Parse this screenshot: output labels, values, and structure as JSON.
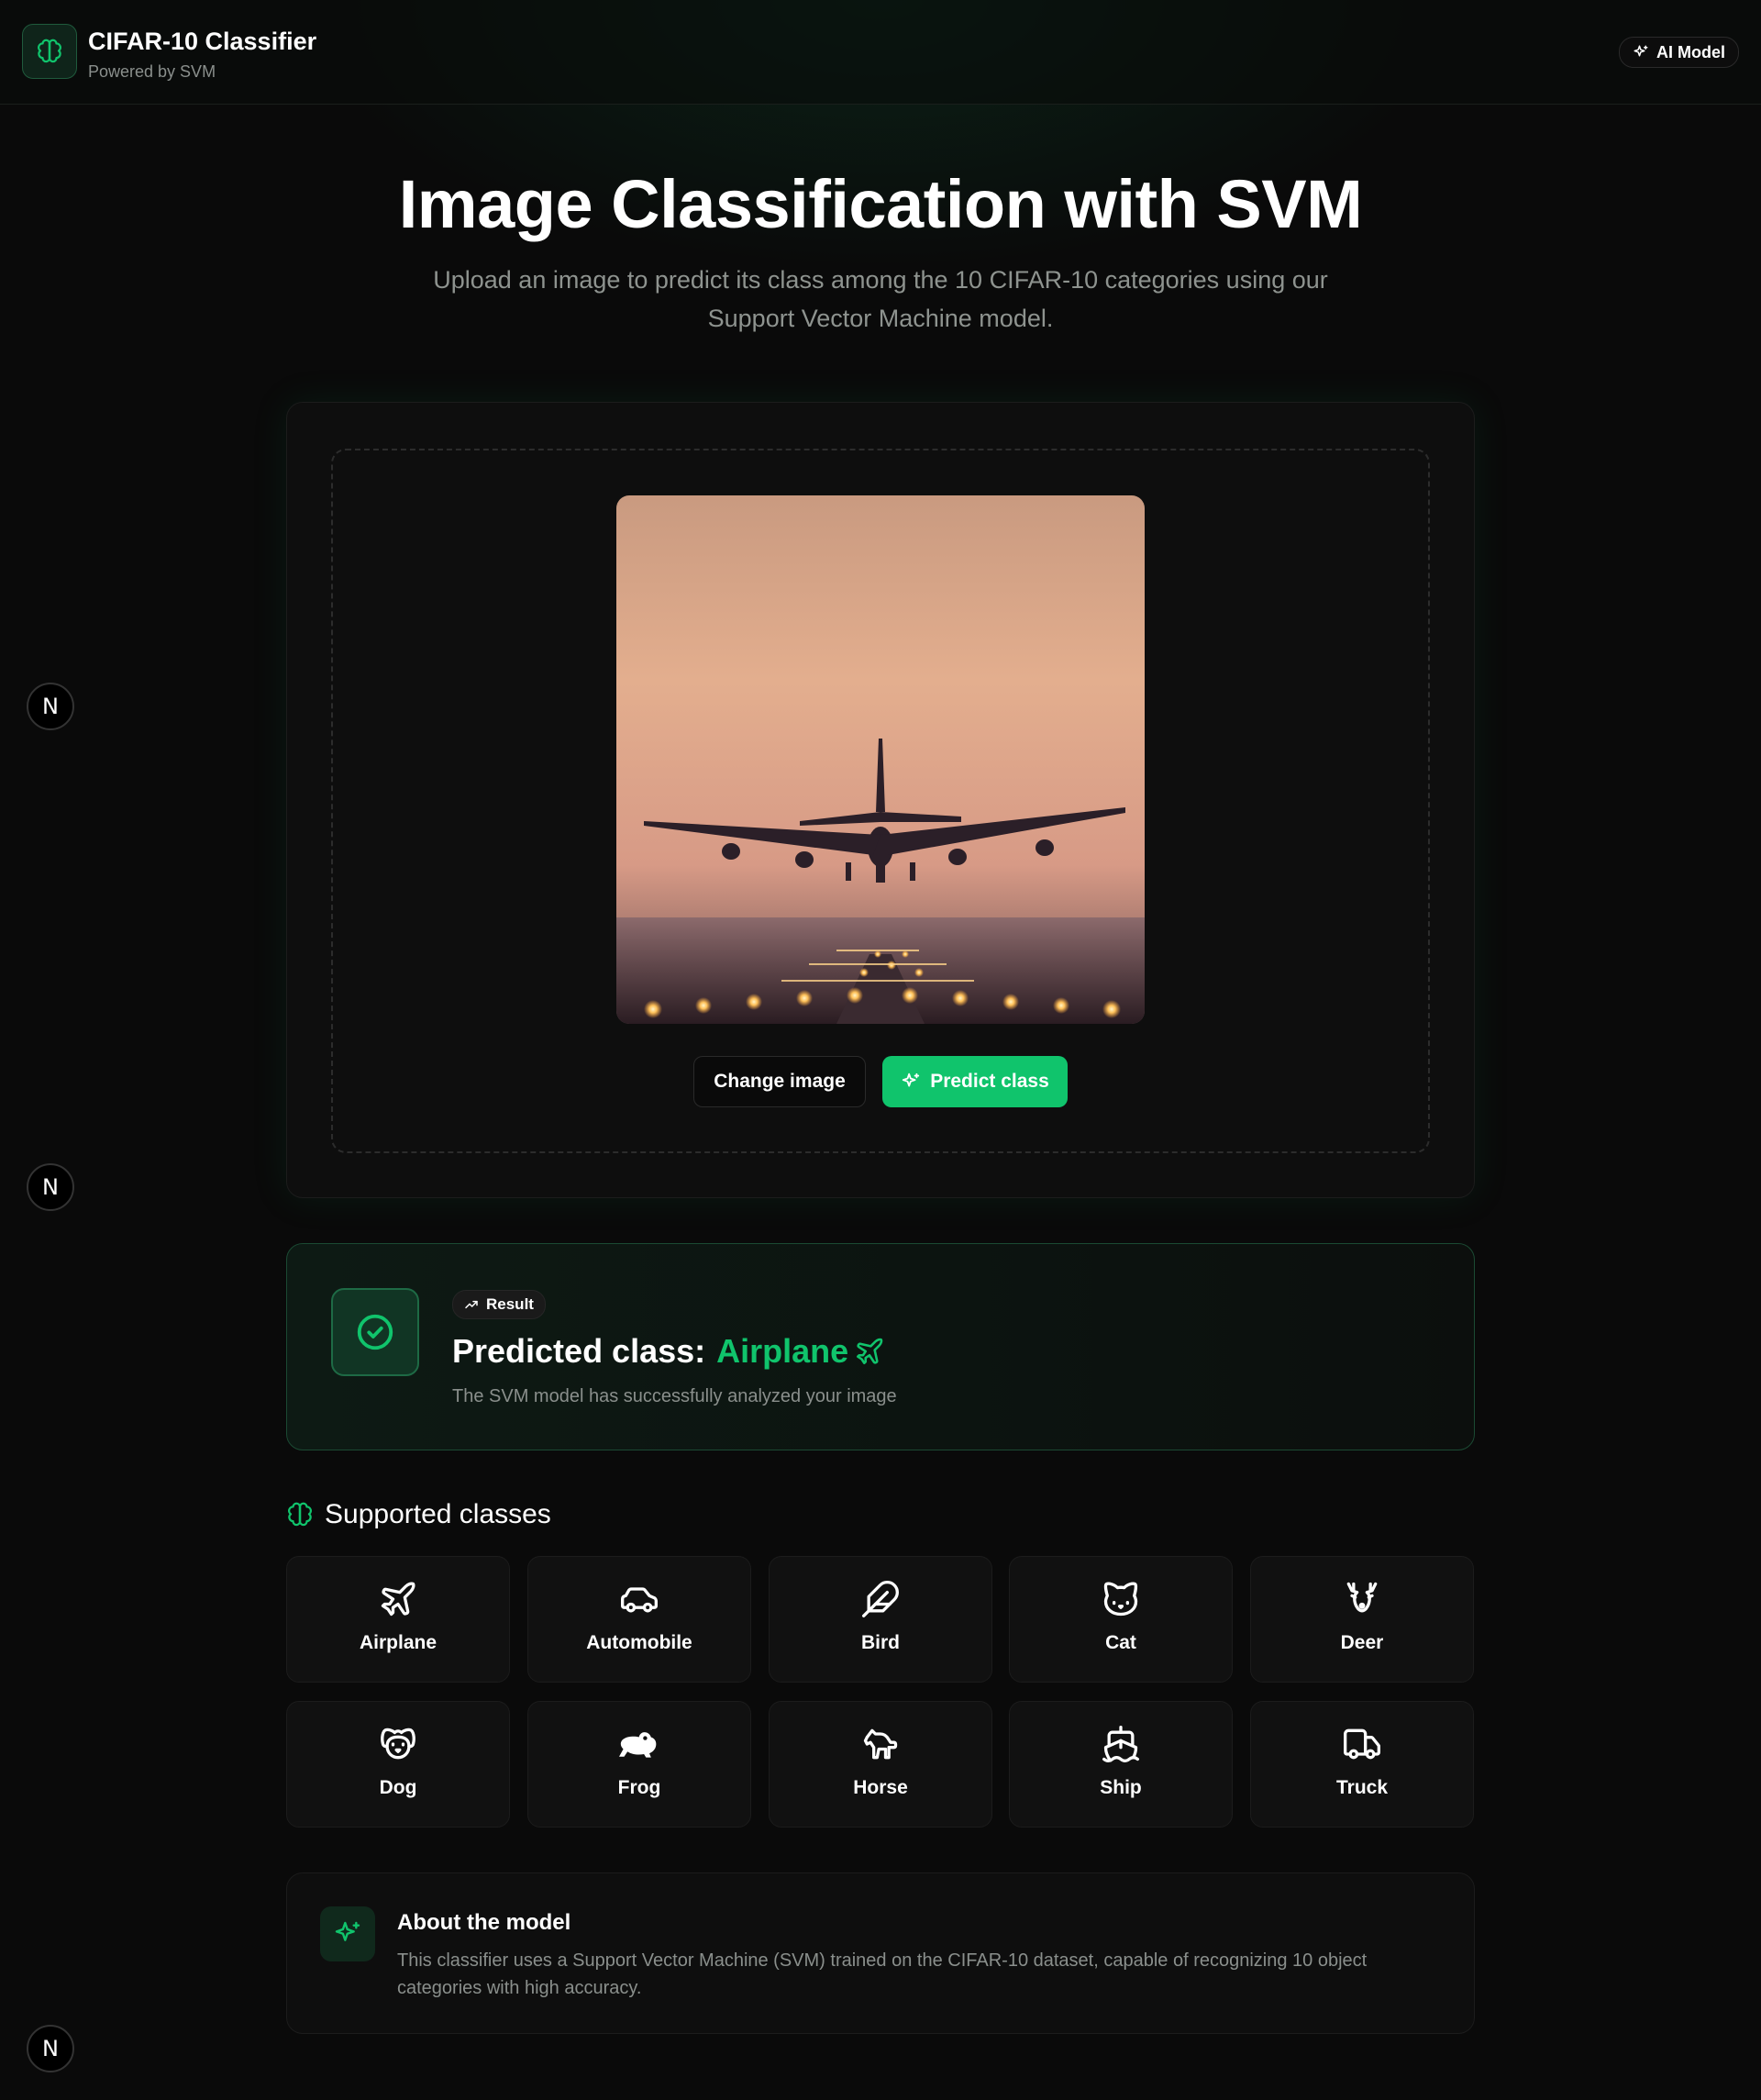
{
  "header": {
    "app_title": "CIFAR-10 Classifier",
    "app_subtitle": "Powered by SVM",
    "badge_label": "AI Model",
    "logo_icon": "brain-icon"
  },
  "side_buttons": [
    "N",
    "N",
    "N"
  ],
  "hero": {
    "title": "Image Classification with SVM",
    "subtitle": "Upload an image to predict its class among the 10 CIFAR-10 categories using our Support Vector Machine model."
  },
  "upload": {
    "preview_alt": "airplane landing at sunset",
    "change_label": "Change image",
    "predict_label": "Predict class"
  },
  "result": {
    "pill_label": "Result",
    "prefix": "Predicted class:",
    "value": "Airplane",
    "description": "The SVM model has successfully analyzed your image"
  },
  "supported": {
    "title": "Supported classes",
    "classes": [
      {
        "label": "Airplane",
        "icon": "plane-icon"
      },
      {
        "label": "Automobile",
        "icon": "car-icon"
      },
      {
        "label": "Bird",
        "icon": "feather-icon"
      },
      {
        "label": "Cat",
        "icon": "cat-icon"
      },
      {
        "label": "Deer",
        "icon": "deer-icon"
      },
      {
        "label": "Dog",
        "icon": "dog-icon"
      },
      {
        "label": "Frog",
        "icon": "frog-icon"
      },
      {
        "label": "Horse",
        "icon": "horse-icon"
      },
      {
        "label": "Ship",
        "icon": "ship-icon"
      },
      {
        "label": "Truck",
        "icon": "truck-icon"
      }
    ]
  },
  "about": {
    "title": "About the model",
    "text": "This classifier uses a Support Vector Machine (SVM) trained on the CIFAR-10 dataset, capable of recognizing 10 object categories with high accuracy."
  },
  "colors": {
    "accent": "#10c46c",
    "background": "#0a0a0a",
    "card": "#111111"
  }
}
